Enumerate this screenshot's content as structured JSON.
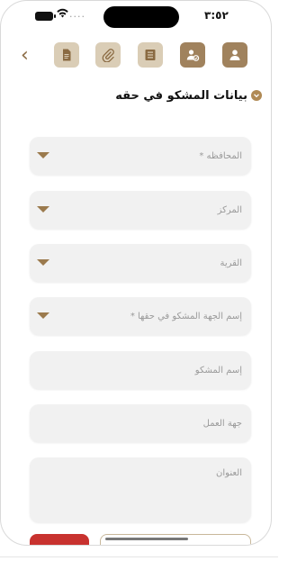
{
  "status_bar": {
    "time": "٣:٥٢",
    "battery_icon": "battery-icon",
    "wifi_icon": "wifi-icon"
  },
  "toolbar": {
    "back_icon": "chevron-left-icon",
    "steps": [
      {
        "icon": "document-icon",
        "state": "inactive"
      },
      {
        "icon": "paperclip-icon",
        "state": "inactive"
      },
      {
        "icon": "list-icon",
        "state": "inactive"
      },
      {
        "icon": "user-shield-icon",
        "state": "active"
      },
      {
        "icon": "user-icon",
        "state": "active"
      }
    ]
  },
  "section": {
    "title": "بيانات المشكو في حقه",
    "icon": "chevron-down-circle-icon"
  },
  "form": {
    "governorate_placeholder": "المحافظه *",
    "center_placeholder": "المركز",
    "village_placeholder": "القرية",
    "entity_placeholder": "إسم الجهة المشكو في حقها *",
    "name_placeholder": "إسم المشكو",
    "workplace_placeholder": "جهة العمل",
    "address_placeholder": "العنوان"
  },
  "colors": {
    "accent": "#a0825d",
    "accent_light": "#dacdb6",
    "danger": "#c8322f",
    "field_bg": "#f1f1f1"
  }
}
